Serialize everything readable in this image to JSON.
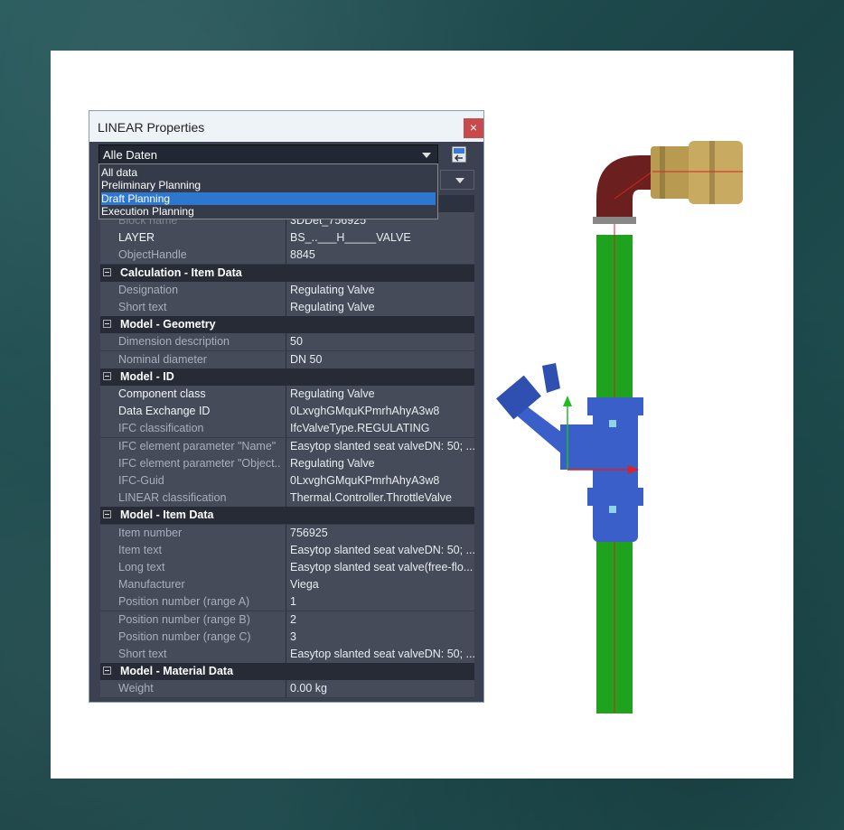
{
  "window": {
    "title": "LINEAR Properties",
    "close_glyph": "×"
  },
  "filter": {
    "selected": "Alle Daten",
    "options": [
      "All data",
      "Preliminary Planning",
      "Draft Planning",
      "Execution Planning"
    ],
    "highlighted_index": 2
  },
  "properties": [
    {
      "type": "prop",
      "key": "Block name",
      "value": "3DDet_756925",
      "style": "grey"
    },
    {
      "type": "prop",
      "key": "LAYER",
      "value": "BS_..___H_____VALVE",
      "style": "bright"
    },
    {
      "type": "prop",
      "key": "ObjectHandle",
      "value": "8845",
      "style": "dim"
    },
    {
      "type": "cat",
      "key": "Calculation - Item Data"
    },
    {
      "type": "prop",
      "key": "Designation",
      "value": "Regulating Valve",
      "style": "dim"
    },
    {
      "type": "prop",
      "key": "Short text",
      "value": "Regulating Valve",
      "style": "dim"
    },
    {
      "type": "cat",
      "key": "Model - Geometry"
    },
    {
      "type": "prop",
      "key": "Dimension description",
      "value": "50",
      "style": "dim"
    },
    {
      "type": "prop",
      "key": "Nominal diameter",
      "value": "DN 50",
      "style": "dim"
    },
    {
      "type": "cat",
      "key": "Model - ID"
    },
    {
      "type": "prop",
      "key": "Component class",
      "value": "Regulating Valve",
      "style": "bright",
      "valueStyle": "grey"
    },
    {
      "type": "prop",
      "key": "Data Exchange ID",
      "value": "0LxvghGMquKPmrhAhyA3w8",
      "style": "bright"
    },
    {
      "type": "prop",
      "key": "IFC classification",
      "value": "IfcValveType.REGULATING",
      "style": "dim"
    },
    {
      "type": "prop",
      "key": "IFC element parameter \"Name\"",
      "value": "Easytop slanted seat valveDN: 50; ...",
      "style": "dim"
    },
    {
      "type": "prop",
      "key": "IFC element parameter \"Object...",
      "value": "Regulating Valve",
      "style": "dim"
    },
    {
      "type": "prop",
      "key": "IFC-Guid",
      "value": "0LxvghGMquKPmrhAhyA3w8",
      "style": "dim"
    },
    {
      "type": "prop",
      "key": "LINEAR classification",
      "value": "Thermal.Controller.ThrottleValve",
      "style": "dim"
    },
    {
      "type": "cat",
      "key": "Model - Item Data"
    },
    {
      "type": "prop",
      "key": "Item number",
      "value": "756925",
      "style": "dim"
    },
    {
      "type": "prop",
      "key": "Item text",
      "value": "Easytop slanted seat valveDN: 50; ...",
      "style": "dim"
    },
    {
      "type": "prop",
      "key": "Long text",
      "value": "Easytop slanted seat valve(free-flo...",
      "style": "dim"
    },
    {
      "type": "prop",
      "key": "Manufacturer",
      "value": "Viega",
      "style": "dim"
    },
    {
      "type": "prop",
      "key": "Position number (range A)",
      "value": "1",
      "style": "dim"
    },
    {
      "type": "prop",
      "key": "Position number (range B)",
      "value": "2",
      "style": "dim"
    },
    {
      "type": "prop",
      "key": "Position number (range C)",
      "value": "3",
      "style": "dim"
    },
    {
      "type": "prop",
      "key": "Short text",
      "value": "Easytop slanted seat valveDN: 50; ...",
      "style": "dim"
    },
    {
      "type": "cat",
      "key": "Model - Material Data"
    },
    {
      "type": "prop",
      "key": "Weight",
      "value": "0.00 kg",
      "style": "dim"
    }
  ],
  "colors": {
    "pipe": "#1fa31f",
    "elbow": "#6b1f1f",
    "coupling": "#b89a50",
    "valve": "#3a5fc9",
    "axis_x": "#dd2222",
    "axis_y": "#22bb22"
  }
}
